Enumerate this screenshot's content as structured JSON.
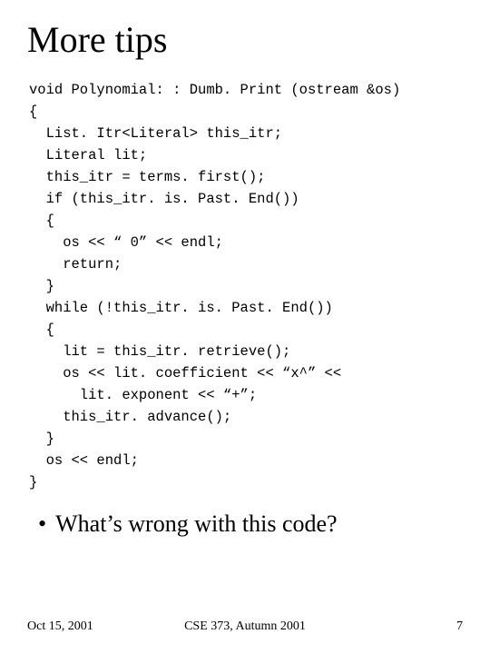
{
  "title": "More tips",
  "code": "void Polynomial: : Dumb. Print (ostream &os)\n{\n  List. Itr<Literal> this_itr;\n  Literal lit;\n  this_itr = terms. first();\n  if (this_itr. is. Past. End())\n  {\n    os << “ 0” << endl;\n    return;\n  }\n  while (!this_itr. is. Past. End())\n  {\n    lit = this_itr. retrieve();\n    os << lit. coefficient << “x^” <<\n      lit. exponent << “+”;\n    this_itr. advance();\n  }\n  os << endl;\n}",
  "bullet": "What’s wrong with this code?",
  "footer": {
    "date": "Oct 15, 2001",
    "course": "CSE 373, Autumn 2001",
    "page": "7"
  }
}
